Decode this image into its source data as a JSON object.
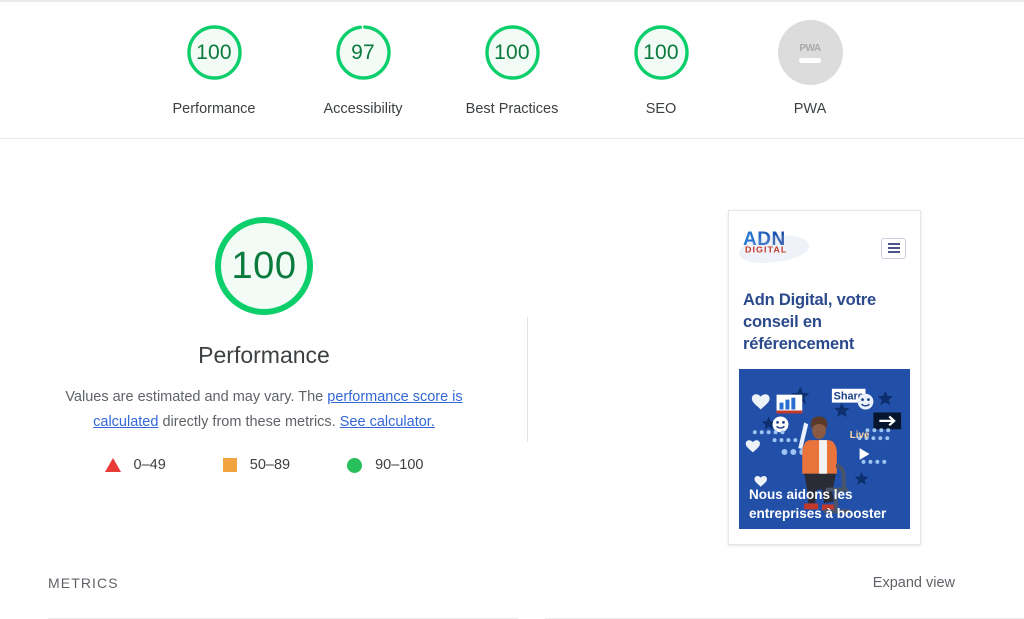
{
  "scores_strip": {
    "items": [
      {
        "value": "100",
        "label": "Performance",
        "state": "pass",
        "percent": 100
      },
      {
        "value": "97",
        "label": "Accessibility",
        "state": "pass",
        "percent": 97
      },
      {
        "value": "100",
        "label": "Best Practices",
        "state": "pass",
        "percent": 100
      },
      {
        "value": "100",
        "label": "SEO",
        "state": "pass",
        "percent": 100
      },
      {
        "value": "PWA",
        "label": "PWA",
        "state": "not-applicable",
        "percent": 0
      }
    ]
  },
  "category": {
    "gauge_value": "100",
    "title": "Performance",
    "disclaimer": {
      "part1": "Values are estimated and may vary. The ",
      "link1": "performance score is calculated",
      "part2": " directly from these metrics. ",
      "link2": "See calculator."
    },
    "legend": [
      {
        "swatch": "triangle-fail-icon",
        "range": "0–49"
      },
      {
        "swatch": "square-average-icon",
        "range": "50–89"
      },
      {
        "swatch": "circle-pass-icon",
        "range": "90–100"
      }
    ]
  },
  "thumbnail": {
    "logo_primary": "ADN",
    "logo_secondary": "DIGITAL",
    "menu_icon": "hamburger-icon",
    "heading": "Adn Digital, votre conseil en référencement",
    "hero_caption": "Nous aidons les entreprises à booster"
  },
  "bottom": {
    "metrics_label": "METRICS",
    "expand_label": "Expand view"
  },
  "colors": {
    "pass_green": "#0cce6b",
    "pass_green_text": "#0b7a3d",
    "pass_fill": "#f2fbf5",
    "average_orange": "#f0a33f",
    "fail_red": "#e83b38",
    "link_blue": "#3367d6",
    "na_grey": "#dcdcdc",
    "brand_blue": "#2250a8"
  }
}
